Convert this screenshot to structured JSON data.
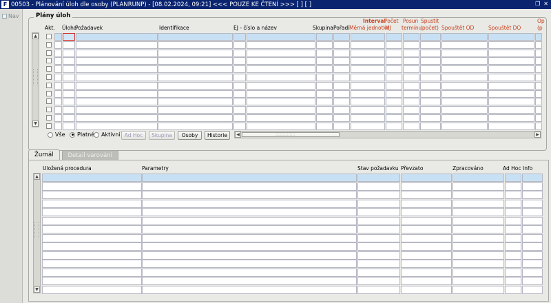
{
  "window": {
    "title": "00503 - Plánování úloh dle osoby (PLANRUNP) - [08.02.2024, 09:21] <<< POUZE KE ČTENÍ >>> [ ] [ ]",
    "app_icon": "F",
    "controls": [
      "restore-icon",
      "close-icon"
    ]
  },
  "nav": {
    "label": "Nav"
  },
  "plans": {
    "group_title": "Plány úloh",
    "headers": {
      "akt": "Akt.",
      "uloha": "Úloha",
      "pozadavek": "Požadavek",
      "identifikace": "Identifikace",
      "ej": "EJ - číslo a název",
      "skupina": "Skupina",
      "poradi": "Pořadí",
      "interval": "Interval",
      "merna": "Měrná jednotka",
      "pocet_top": "Počet",
      "pocet_mj": "MJ",
      "posun_top": "Posun",
      "posun_bottom": "termínu",
      "spustit_top": "Spustit",
      "spustit_bottom": "(počet)",
      "spoustet_od": "Spouštět OD",
      "spoustet_do": "Spouštět DO",
      "op_top": "Op",
      "op_bottom": "(p"
    },
    "row_count": 12,
    "filter": {
      "options": [
        "Vše",
        "Platné",
        "Aktivní"
      ],
      "selected": "Platné"
    },
    "buttons": {
      "ad_hoc": "Ad Hoc",
      "skupina": "Skupina",
      "osoby": "Osoby",
      "historie": "Historie"
    },
    "hscroll_grip": "::::::::::::::"
  },
  "tabs": [
    "Žurnál",
    "Detail varování"
  ],
  "active_tab": "Žurnál",
  "journal": {
    "headers": {
      "procedura": "Uložená procedura",
      "parametry": "Parametry",
      "stav": "Stav požadavku",
      "prevzato": "Převzato",
      "zpracovano": "Zpracováno",
      "adhoc": "Ad Hoc",
      "info": "Info"
    },
    "row_count": 14
  },
  "colors": {
    "titlebar": "#0a2470",
    "selected_row": "#c8e0f4",
    "red_header": "#c8401a",
    "focus_border": "#d3302b"
  }
}
